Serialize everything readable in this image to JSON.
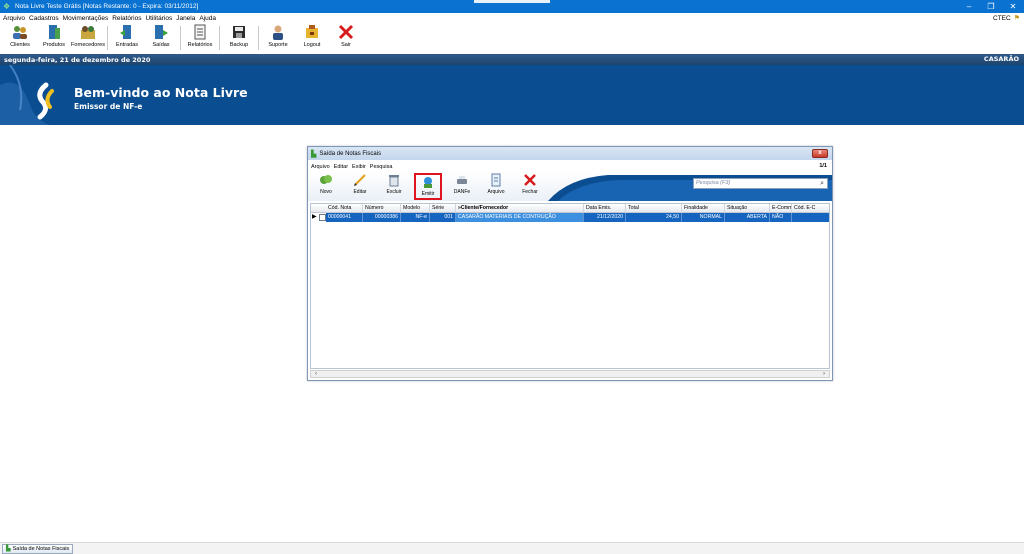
{
  "titlebar": {
    "title": "Nota Livre Teste Grátis [Notas Restante: 0 - Expira: 03/11/2012]",
    "minimize": "–",
    "restore": "❐",
    "close": "✕"
  },
  "menubar": {
    "items": [
      "Arquivo",
      "Cadastros",
      "Movimentações",
      "Relatórios",
      "Utilitários",
      "Janela",
      "Ajuda"
    ],
    "user": "CTEC"
  },
  "toolbar": {
    "buttons": [
      {
        "label": "Clientes",
        "icon": "clients-icon"
      },
      {
        "label": "Produtos",
        "icon": "products-icon"
      },
      {
        "label": "Fornecedores",
        "icon": "suppliers-icon"
      },
      {
        "label": "Entradas",
        "icon": "entries-icon"
      },
      {
        "label": "Saídas",
        "icon": "exits-icon"
      },
      {
        "label": "Relatórios",
        "icon": "reports-icon"
      },
      {
        "label": "Backup",
        "icon": "save-icon"
      },
      {
        "label": "Suporte",
        "icon": "support-icon"
      },
      {
        "label": "Logout",
        "icon": "logout-icon"
      },
      {
        "label": "Sair",
        "icon": "exit-icon"
      }
    ]
  },
  "datebar": {
    "date": "segunda-feira, 21 de dezembro de 2020",
    "company": "CASARÃO"
  },
  "banner": {
    "title": "Bem-vindo ao Nota Livre",
    "subtitle": "Emissor de NF-e"
  },
  "window": {
    "title": "Saída de Notas Fiscais",
    "close": "x",
    "menu": [
      "Arquivo",
      "Editar",
      "Exibir",
      "Pesquisa"
    ],
    "page": "1/1",
    "buttons": [
      {
        "label": "Novo",
        "icon": "new-icon"
      },
      {
        "label": "Editar",
        "icon": "edit-icon"
      },
      {
        "label": "Excluir",
        "icon": "delete-icon"
      },
      {
        "label": "Emitir",
        "icon": "emit-icon"
      },
      {
        "label": "DANFe",
        "icon": "printer-icon"
      },
      {
        "label": "Arquivo",
        "icon": "file-icon"
      },
      {
        "label": "Fechar",
        "icon": "close-icon"
      }
    ],
    "search_placeholder": "Pesquisa (F3)",
    "columns": [
      "Cód. Nota",
      "Número",
      "Modelo",
      "Série",
      "»Cliente/Fornecedor",
      "Data Emis.",
      "Total",
      "Finalidade",
      "Situação",
      "E-Commerce",
      "Cód. E-C"
    ],
    "rows": [
      [
        "00000041",
        "00000386",
        "NF-e",
        "001",
        "CASARÃO MATERIAIS DE CONTRUÇÃO",
        "21/12/2020",
        "24,50",
        "NORMAL",
        "ABERTA",
        "NÃO",
        ""
      ]
    ]
  },
  "taskbar": {
    "task": "Saída de Notas Fiscais"
  },
  "colors": {
    "titlebar": "#0a73d1",
    "banner": "#0b4d91",
    "selection": "#1565c0",
    "highlight": "#e0141e"
  }
}
